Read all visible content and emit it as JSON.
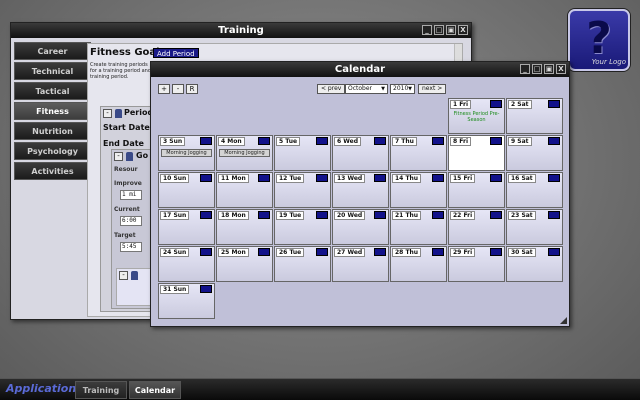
{
  "logo": {
    "glyph": "?",
    "caption": "Your Logo"
  },
  "training": {
    "title": "Training",
    "window_buttons": [
      "_",
      "□",
      "▣",
      "X"
    ],
    "nav": [
      {
        "label": "Career"
      },
      {
        "label": "Technical"
      },
      {
        "label": "Tactical"
      },
      {
        "label": "Fitness",
        "active": true
      },
      {
        "label": "Nutrition"
      },
      {
        "label": "Psychology"
      },
      {
        "label": "Activities"
      }
    ],
    "fitness_goals_title": "Fitness Goals",
    "add_period_label": "Add Period",
    "description": "Create training periods for a training period and training period.",
    "period_label": "Period",
    "start_date_label": "Start Date",
    "end_date_label": "End Date",
    "goal_label": "Go",
    "resource_label": "Resour",
    "improve_label": "Improve",
    "improve_value": "1 mi",
    "current_label": "Current",
    "current_value": "6:00",
    "target_label": "Target",
    "target_value": "5:45"
  },
  "calendar": {
    "title": "Calendar",
    "window_buttons": [
      "_",
      "□",
      "▣",
      "X"
    ],
    "zoom_buttons": [
      "+",
      "-",
      "R"
    ],
    "prev_label": "< prev",
    "next_label": "next >",
    "month": "October",
    "year": "2010",
    "leading_blanks": 5,
    "today_day": 8,
    "days": [
      {
        "label": "1 Fri",
        "event": "Fitness Period Pre-Season",
        "event_style": "green"
      },
      {
        "label": "2 Sat"
      },
      {
        "label": "3 Sun",
        "event": "Morning Jogging",
        "event_style": "box"
      },
      {
        "label": "4 Mon",
        "event": "Morning Jogging",
        "event_style": "box"
      },
      {
        "label": "5 Tue"
      },
      {
        "label": "6 Wed"
      },
      {
        "label": "7 Thu"
      },
      {
        "label": "8 Fri"
      },
      {
        "label": "9 Sat"
      },
      {
        "label": "10 Sun"
      },
      {
        "label": "11 Mon"
      },
      {
        "label": "12 Tue"
      },
      {
        "label": "13 Wed"
      },
      {
        "label": "14 Thu"
      },
      {
        "label": "15 Fri"
      },
      {
        "label": "16 Sat"
      },
      {
        "label": "17 Sun"
      },
      {
        "label": "18 Mon"
      },
      {
        "label": "19 Tue"
      },
      {
        "label": "20 Wed"
      },
      {
        "label": "21 Thu"
      },
      {
        "label": "22 Fri"
      },
      {
        "label": "23 Sat"
      },
      {
        "label": "24 Sun"
      },
      {
        "label": "25 Mon"
      },
      {
        "label": "26 Tue"
      },
      {
        "label": "27 Wed"
      },
      {
        "label": "28 Thu"
      },
      {
        "label": "29 Fri"
      },
      {
        "label": "30 Sat"
      },
      {
        "label": "31 Sun"
      }
    ]
  },
  "taskbar": {
    "apps_label": "Applications",
    "tasks": [
      {
        "label": "Training"
      },
      {
        "label": "Calendar",
        "active": true
      }
    ]
  }
}
